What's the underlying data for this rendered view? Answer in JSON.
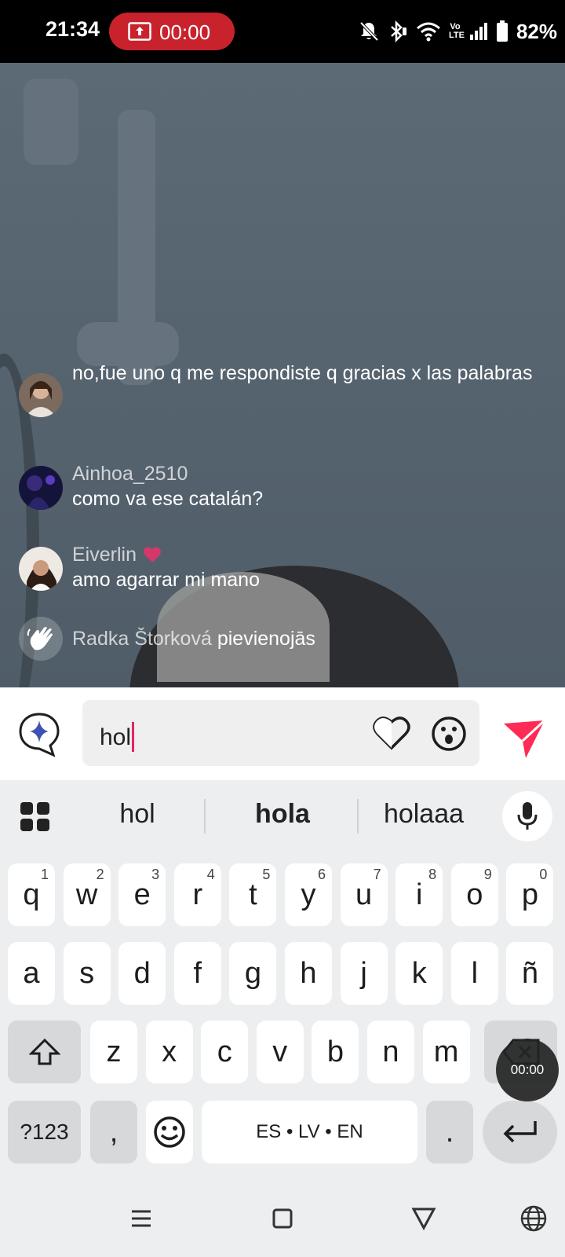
{
  "status_bar": {
    "time": "21:34",
    "recording_time": "00:00",
    "volte_top": "Vo",
    "volte_bottom": "LTE",
    "battery_percent": "82%",
    "icons": [
      "mute-icon",
      "bluetooth-icon",
      "wifi-icon",
      "volte-icon",
      "signal-icon",
      "battery-icon"
    ]
  },
  "comments": [
    {
      "username": "",
      "text": "no,fue uno q me respondiste q gracias x las palabras"
    },
    {
      "username": "Ainhoa_2510",
      "text": "como va ese catalán?"
    },
    {
      "username": "Eiverlin",
      "badge": "heart-icon",
      "text": "amo agarrar mi mano"
    }
  ],
  "join_event": {
    "username": "Radka Štorková",
    "action": "pievienojās"
  },
  "comment_input": {
    "value": "hol"
  },
  "keyboard": {
    "suggestions": [
      "hol",
      "hola",
      "holaaa"
    ],
    "row1": [
      {
        "k": "q",
        "h": "1"
      },
      {
        "k": "w",
        "h": "2"
      },
      {
        "k": "e",
        "h": "3"
      },
      {
        "k": "r",
        "h": "4"
      },
      {
        "k": "t",
        "h": "5"
      },
      {
        "k": "y",
        "h": "6"
      },
      {
        "k": "u",
        "h": "7"
      },
      {
        "k": "i",
        "h": "8"
      },
      {
        "k": "o",
        "h": "9"
      },
      {
        "k": "p",
        "h": "0"
      }
    ],
    "row2": [
      "a",
      "s",
      "d",
      "f",
      "g",
      "h",
      "j",
      "k",
      "l",
      "ñ"
    ],
    "row3": [
      "z",
      "x",
      "c",
      "v",
      "b",
      "n",
      "m"
    ],
    "symbols_label": "?123",
    "comma": ",",
    "space_label": "ES • LV • EN",
    "period": "."
  },
  "floating_recorder": {
    "time": "00:00"
  },
  "colors": {
    "accent": "#e7245f",
    "record_red": "#c8232c",
    "send": "#ff2a55"
  }
}
